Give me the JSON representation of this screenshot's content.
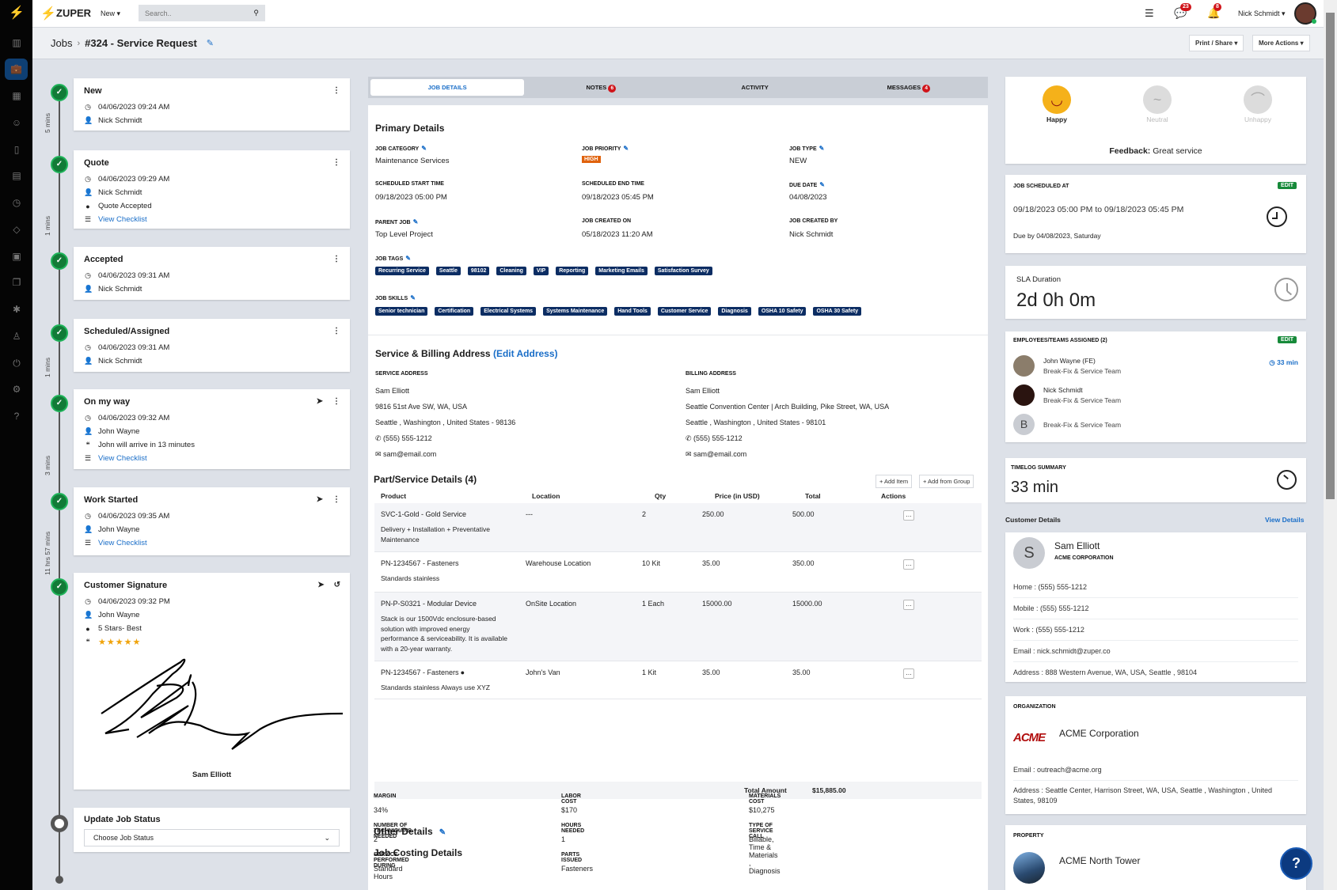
{
  "topbar": {
    "logo": "ZUPER",
    "new_label": "New",
    "search_placeholder": "Search..",
    "chat_badge": "23",
    "bell_badge": "8",
    "user_name": "Nick Schmidt"
  },
  "breadcrumb": {
    "root": "Jobs",
    "separator": "›",
    "title": "#324 - Service Request"
  },
  "header_actions": {
    "print": "Print / Share",
    "more": "More Actions"
  },
  "timeline": {
    "durations": [
      "5 mins",
      "1 mins",
      "1 mins",
      "3 mins",
      "11 hrs 57 mins"
    ],
    "stages": [
      {
        "title": "New",
        "time": "04/06/2023 09:24 AM",
        "user": "Nick Schmidt"
      },
      {
        "title": "Quote",
        "time": "04/06/2023 09:29 AM",
        "user": "Nick Schmidt",
        "info": "Quote Accepted",
        "checklist": "View Checklist"
      },
      {
        "title": "Accepted",
        "time": "04/06/2023 09:31 AM",
        "user": "Nick Schmidt"
      },
      {
        "title": "Scheduled/Assigned",
        "time": "04/06/2023 09:31 AM",
        "user": "Nick Schmidt"
      },
      {
        "title": "On my way",
        "time": "04/06/2023 09:32 AM",
        "user": "John Wayne",
        "quote": "John will arrive in 13 minutes",
        "checklist": "View Checklist"
      },
      {
        "title": "Work Started",
        "time": "04/06/2023 09:35 AM",
        "user": "John Wayne",
        "checklist": "View Checklist"
      },
      {
        "title": "Customer Signature",
        "time": "04/06/2023 09:32 PM",
        "user": "John Wayne",
        "info": "5 Stars- Best",
        "rating": 5,
        "signer": "Sam Elliott"
      }
    ],
    "update": {
      "title": "Update Job Status",
      "placeholder": "Choose Job Status"
    }
  },
  "tabs": [
    {
      "label": "JOB DETAILS"
    },
    {
      "label": "NOTES",
      "badge": "6"
    },
    {
      "label": "ACTIVITY"
    },
    {
      "label": "MESSAGES",
      "badge": "4"
    }
  ],
  "primary": {
    "title": "Primary Details",
    "fields": [
      {
        "label": "JOB CATEGORY",
        "value": "Maintenance Services",
        "edit": true
      },
      {
        "label": "JOB PRIORITY",
        "value": "HIGH",
        "edit": true
      },
      {
        "label": "JOB TYPE",
        "value": "NEW",
        "edit": true
      },
      {
        "label": "SCHEDULED START TIME",
        "value": "09/18/2023 05:00 PM"
      },
      {
        "label": "SCHEDULED END TIME",
        "value": "09/18/2023 05:45 PM"
      },
      {
        "label": "DUE DATE",
        "value": "04/08/2023",
        "edit": true
      },
      {
        "label": "PARENT JOB",
        "value": "Top Level Project",
        "edit": true
      },
      {
        "label": "JOB CREATED ON",
        "value": "05/18/2023 11:20 AM"
      },
      {
        "label": "JOB CREATED BY",
        "value": "Nick Schmidt"
      }
    ],
    "tags_label": "JOB TAGS",
    "tags": [
      "Recurring Service",
      "Seattle",
      "98102",
      "Cleaning",
      "VIP",
      "Reporting",
      "Marketing Emails",
      "Satisfaction Survey"
    ],
    "skills_label": "JOB SKILLS",
    "skills": [
      "Senior technician",
      "Certification",
      "Electrical Systems",
      "Systems Maintenance",
      "Hand Tools",
      "Customer Service",
      "Diagnosis",
      "OSHA 10 Safety",
      "OSHA 30 Safety"
    ]
  },
  "address": {
    "title": "Service & Billing Address",
    "edit_link": "(Edit Address)",
    "service": {
      "label": "SERVICE ADDRESS",
      "name": "Sam Elliott",
      "line1": "9816 51st Ave SW, WA, USA",
      "line2": "Seattle , Washington , United States - 98136",
      "phone": "(555) 555-1212",
      "email": "sam@email.com"
    },
    "billing": {
      "label": "BILLING ADDRESS",
      "name": "Sam Elliott",
      "line1": "Seattle Convention Center | Arch Building, Pike Street, WA, USA",
      "line2": "Seattle , Washington , United States - 98101",
      "phone": "(555) 555-1212",
      "email": "sam@email.com"
    }
  },
  "parts": {
    "title": "Part/Service Details (4)",
    "add_item": "+ Add Item",
    "add_group": "+ Add from Group",
    "columns": [
      "Product",
      "Location",
      "Qty",
      "Price (in USD)",
      "Total",
      "Actions"
    ],
    "rows": [
      {
        "product": "SVC-1-Gold - Gold Service",
        "desc": "Delivery + Installation + Preventative Maintenance",
        "location": "---",
        "qty": "2",
        "price": "250.00",
        "total": "500.00"
      },
      {
        "product": "PN-1234567 - Fasteners",
        "desc": "Standards stainless",
        "location": "Warehouse Location",
        "qty": "10 Kit",
        "price": "35.00",
        "total": "350.00"
      },
      {
        "product": "PN-P-S0321 - Modular Device",
        "desc": "Stack is our 1500Vdc enclosure-based solution with improved energy performance & serviceability. It is available with a 20-year warranty.",
        "location": "OnSite Location",
        "qty": "1 Each",
        "price": "15000.00",
        "total": "15000.00"
      },
      {
        "product": "PN-1234567 - Fasteners",
        "desc": "Standards stainless Always use XYZ",
        "location": "John's Van",
        "qty": "1 Kit",
        "price": "35.00",
        "total": "35.00",
        "info": true
      }
    ],
    "total_label": "Total Amount",
    "total": "$15,885.00"
  },
  "other": {
    "title": "Other Details",
    "costing_title": "Job Costing Details",
    "fields": [
      {
        "label": "MARGIN",
        "value": "34%"
      },
      {
        "label": "LABOR COST",
        "value": "$170"
      },
      {
        "label": "MATERIALS COST",
        "value": "$10,275"
      },
      {
        "label": "NUMBER OF TECHNICIANS NEEDED",
        "value": "2"
      },
      {
        "label": "HOURS NEEDED",
        "value": "1"
      },
      {
        "label": "TYPE OF SERVICE CALL",
        "value": "Billable, Time & Materials , Diagnosis"
      },
      {
        "label": "SERVICE PERFORMED DURING",
        "value": "Standard Hours"
      },
      {
        "label": "PARTS ISSUED",
        "value": "Fasteners"
      }
    ]
  },
  "feedback": {
    "options": [
      "Happy",
      "Neutral",
      "Unhappy"
    ],
    "selected": "Happy",
    "label": "Feedback:",
    "text": "Great service"
  },
  "schedule": {
    "label": "JOB SCHEDULED AT",
    "edit": "EDIT",
    "range": "09/18/2023 05:00 PM to 09/18/2023 05:45 PM",
    "due": "Due by 04/08/2023, Saturday"
  },
  "sla": {
    "label": "SLA Duration",
    "value": "2d 0h 0m"
  },
  "assigned": {
    "label": "EMPLOYEES/TEAMS ASSIGNED (2)",
    "edit": "EDIT",
    "time": "33 min",
    "people": [
      {
        "name": "John Wayne (FE)",
        "team": "Break-Fix & Service Team"
      },
      {
        "name": "Nick Schmidt",
        "team": "Break-Fix & Service Team"
      },
      {
        "initial": "B",
        "team": "Break-Fix & Service Team"
      }
    ]
  },
  "timelog": {
    "label": "TIMELOG SUMMARY",
    "value": "33 min"
  },
  "customer": {
    "section": "Customer Details",
    "view": "View Details",
    "initial": "S",
    "name": "Sam Elliott",
    "company": "ACME CORPORATION",
    "lines": [
      "Home : (555) 555-1212",
      "Mobile : (555) 555-1212",
      "Work : (555) 555-1212",
      "Email : nick.schmidt@zuper.co",
      "Address : 888 Western Avenue, WA, USA, Seattle , 98104"
    ]
  },
  "organization": {
    "label": "ORGANIZATION",
    "logo_text": "ACME",
    "name": "ACME Corporation",
    "email": "Email : outreach@acme.org",
    "address": "Address : Seattle Center, Harrison Street, WA, USA, Seattle , Washington , United States, 98109"
  },
  "property": {
    "label": "PROPERTY",
    "name": "ACME North Tower"
  },
  "colors": {
    "brand": "#0c2d63",
    "link": "#1a6ec8",
    "success": "#127b37",
    "danger": "#d0141a",
    "priority": "#e0620d"
  }
}
